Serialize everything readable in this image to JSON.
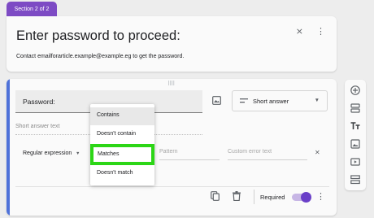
{
  "section_tab": "Section 2 of 2",
  "header": {
    "title": "Enter password to proceed:",
    "description": "Contact emailforarticle.example@example.eg to get the password."
  },
  "question": {
    "title": "Password:",
    "type": "Short answer",
    "answer_hint": "Short answer text",
    "validation_type": "Regular expression",
    "pattern_placeholder": "Pattern",
    "error_placeholder": "Custom error text",
    "required_label": "Required",
    "required_on": true
  },
  "dropdown": {
    "items": [
      "Contains",
      "Doesn't contain",
      "Matches",
      "Doesn't match"
    ],
    "highlighted": "Matches"
  },
  "colors": {
    "accent": "#4f72d9",
    "section_tab": "#7d4bc4",
    "highlight": "#2cd616",
    "toggle": "#6a3fc8"
  },
  "icons": {
    "side_toolbar": [
      "add-question-icon",
      "import-questions-icon",
      "add-title-icon",
      "add-image-icon",
      "add-video-icon",
      "add-section-icon"
    ]
  }
}
